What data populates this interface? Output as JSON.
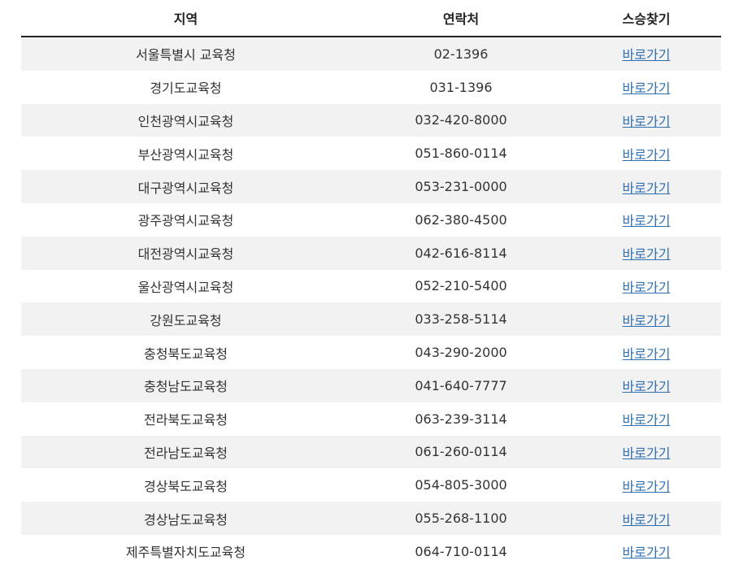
{
  "header": {
    "region": "지역",
    "contact": "연락처",
    "find_teacher": "스승찾기"
  },
  "rows": [
    {
      "region": "서울특별시 교육청",
      "phone": "02-1396",
      "link": "바로가기"
    },
    {
      "region": "경기도교육청",
      "phone": "031-1396",
      "link": "바로가기"
    },
    {
      "region": "인천광역시교육청",
      "phone": "032-420-8000",
      "link": "바로가기"
    },
    {
      "region": "부산광역시교육청",
      "phone": "051-860-0114",
      "link": "바로가기"
    },
    {
      "region": "대구광역시교육청",
      "phone": "053-231-0000",
      "link": "바로가기"
    },
    {
      "region": "광주광역시교육청",
      "phone": "062-380-4500",
      "link": "바로가기"
    },
    {
      "region": "대전광역시교육청",
      "phone": "042-616-8114",
      "link": "바로가기"
    },
    {
      "region": "울산광역시교육청",
      "phone": "052-210-5400",
      "link": "바로가기"
    },
    {
      "region": "강원도교육청",
      "phone": "033-258-5114",
      "link": "바로가기"
    },
    {
      "region": "충청북도교육청",
      "phone": "043-290-2000",
      "link": "바로가기"
    },
    {
      "region": "충청남도교육청",
      "phone": "041-640-7777",
      "link": "바로가기"
    },
    {
      "region": "전라북도교육청",
      "phone": "063-239-3114",
      "link": "바로가기"
    },
    {
      "region": "전라남도교육청",
      "phone": "061-260-0114",
      "link": "바로가기"
    },
    {
      "region": "경상북도교육청",
      "phone": "054-805-3000",
      "link": "바로가기"
    },
    {
      "region": "경상남도교육청",
      "phone": "055-268-1100",
      "link": "바로가기"
    },
    {
      "region": "제주특별자치도교육청",
      "phone": "064-710-0114",
      "link": "바로가기"
    }
  ],
  "colors": {
    "link": "#2f6fb0",
    "stripe": "#f2f2f2",
    "header_rule": "#222222"
  }
}
